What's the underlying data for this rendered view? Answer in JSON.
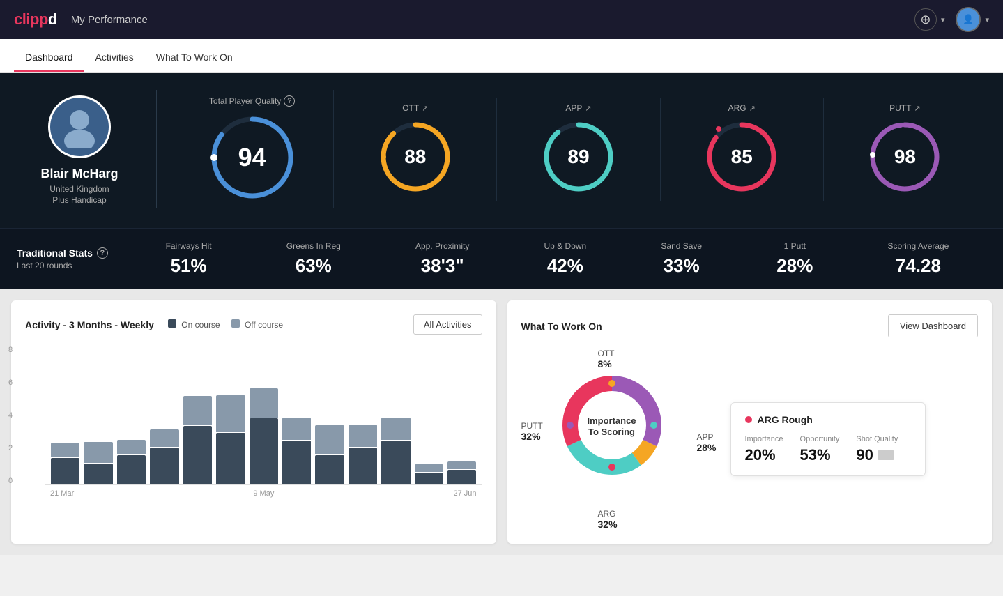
{
  "app": {
    "logo": "clippd",
    "title": "My Performance"
  },
  "nav": {
    "tabs": [
      {
        "id": "dashboard",
        "label": "Dashboard",
        "active": true
      },
      {
        "id": "activities",
        "label": "Activities",
        "active": false
      },
      {
        "id": "what-to-work-on",
        "label": "What To Work On",
        "active": false
      }
    ]
  },
  "player": {
    "name": "Blair McHarg",
    "country": "United Kingdom",
    "handicap": "Plus Handicap"
  },
  "scores": {
    "total": {
      "label": "Total Player Quality",
      "value": 94,
      "color": "#4a90d9",
      "pct": 94
    },
    "ott": {
      "label": "OTT",
      "value": 88,
      "color": "#f5a623",
      "pct": 88,
      "trend": "↗"
    },
    "app": {
      "label": "APP",
      "value": 89,
      "color": "#4ecdc4",
      "pct": 89,
      "trend": "↗"
    },
    "arg": {
      "label": "ARG",
      "value": 85,
      "color": "#e8365d",
      "pct": 85,
      "trend": "↗"
    },
    "putt": {
      "label": "PUTT",
      "value": 98,
      "color": "#9b59b6",
      "pct": 98,
      "trend": "↗"
    }
  },
  "traditional_stats": {
    "title": "Traditional Stats",
    "subtitle": "Last 20 rounds",
    "stats": [
      {
        "label": "Fairways Hit",
        "value": "51%"
      },
      {
        "label": "Greens In Reg",
        "value": "63%"
      },
      {
        "label": "App. Proximity",
        "value": "38'3\""
      },
      {
        "label": "Up & Down",
        "value": "42%"
      },
      {
        "label": "Sand Save",
        "value": "33%"
      },
      {
        "label": "1 Putt",
        "value": "28%"
      },
      {
        "label": "Scoring Average",
        "value": "74.28"
      }
    ]
  },
  "activity_chart": {
    "title": "Activity - 3 Months - Weekly",
    "legend": {
      "oncourse": "On course",
      "offcourse": "Off course"
    },
    "all_button": "All Activities",
    "x_labels": [
      "21 Mar",
      "9 May",
      "27 Jun"
    ],
    "y_labels": [
      "8",
      "6",
      "4",
      "2",
      "0"
    ],
    "bars": [
      {
        "on": 18,
        "off": 10
      },
      {
        "on": 14,
        "off": 14
      },
      {
        "on": 20,
        "off": 10
      },
      {
        "on": 25,
        "off": 12
      },
      {
        "on": 40,
        "off": 20
      },
      {
        "on": 35,
        "off": 25
      },
      {
        "on": 45,
        "off": 20
      },
      {
        "on": 30,
        "off": 15
      },
      {
        "on": 20,
        "off": 20
      },
      {
        "on": 25,
        "off": 15
      },
      {
        "on": 30,
        "off": 15
      },
      {
        "on": 8,
        "off": 5
      },
      {
        "on": 10,
        "off": 5
      }
    ]
  },
  "what_to_work_on": {
    "title": "What To Work On",
    "view_dashboard": "View Dashboard",
    "donut_center": "Importance\nTo Scoring",
    "segments": [
      {
        "label": "OTT",
        "pct": "8%",
        "color": "#f5a623",
        "position": "top"
      },
      {
        "label": "APP",
        "pct": "28%",
        "color": "#4ecdc4",
        "position": "right"
      },
      {
        "label": "ARG",
        "pct": "32%",
        "color": "#e8365d",
        "position": "bottom"
      },
      {
        "label": "PUTT",
        "pct": "32%",
        "color": "#9b59b6",
        "position": "left"
      }
    ],
    "card": {
      "title": "ARG Rough",
      "metrics": [
        {
          "label": "Importance",
          "value": "20%"
        },
        {
          "label": "Opportunity",
          "value": "53%"
        },
        {
          "label": "Shot Quality",
          "value": "90"
        }
      ]
    }
  }
}
